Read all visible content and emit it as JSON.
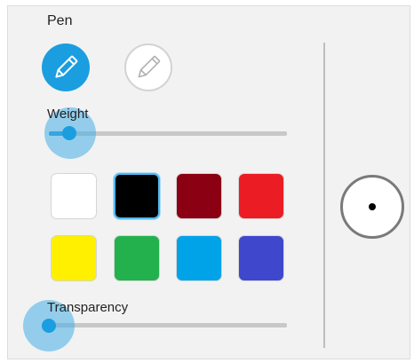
{
  "panel": {
    "title": "Pen"
  },
  "tools": [
    {
      "name": "pen",
      "icon": "pen-icon",
      "selected": true
    },
    {
      "name": "pencil",
      "icon": "pencil-icon",
      "selected": false
    }
  ],
  "weight": {
    "label": "Weight",
    "value_fraction": 0.09
  },
  "colors": [
    {
      "hex": "#ffffff",
      "selected": false
    },
    {
      "hex": "#000000",
      "selected": true
    },
    {
      "hex": "#8b0013",
      "selected": false
    },
    {
      "hex": "#ec1c24",
      "selected": false
    },
    {
      "hex": "#fff000",
      "selected": false
    },
    {
      "hex": "#22b14c",
      "selected": false
    },
    {
      "hex": "#00a2e8",
      "selected": false
    },
    {
      "hex": "#3f48cc",
      "selected": false
    }
  ],
  "transparency": {
    "label": "Transparency",
    "value_fraction": 0.0
  },
  "accent": "#1a9ee0",
  "preview": {
    "dot_color": "#000000"
  }
}
